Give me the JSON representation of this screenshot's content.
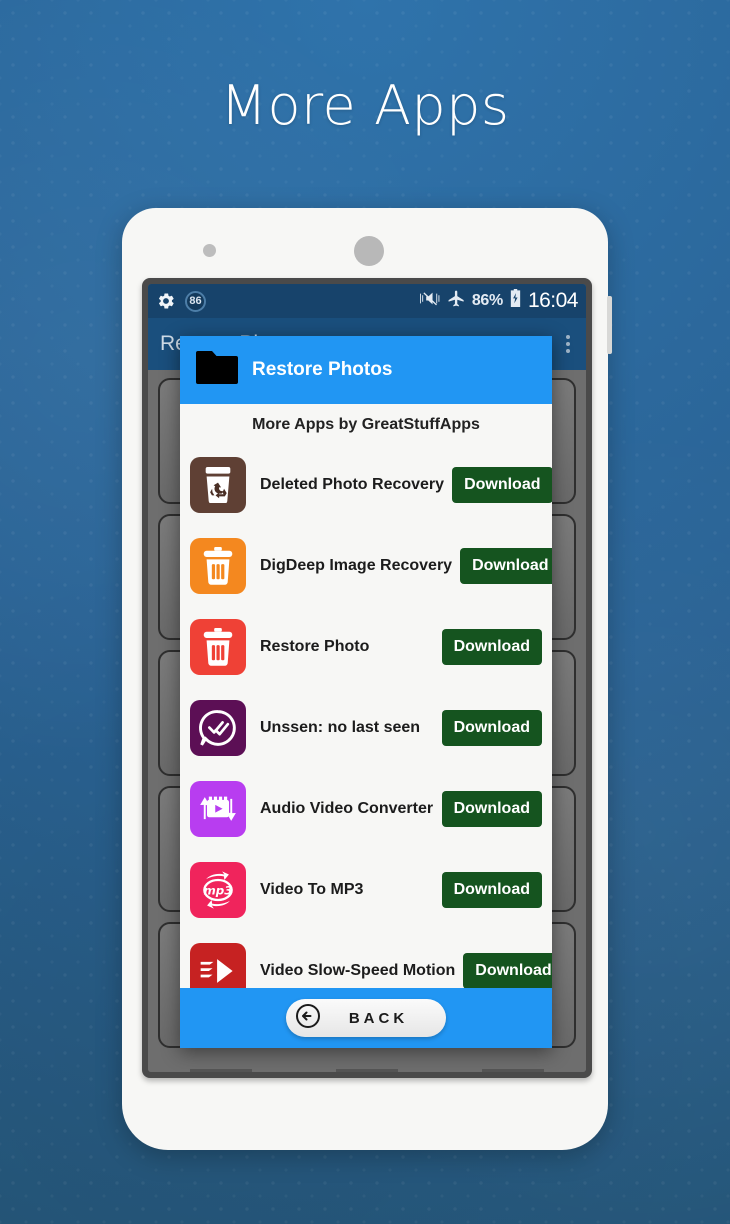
{
  "page": {
    "headline": "More Apps",
    "background_color": "#2a6395",
    "accent_blue": "#2196f3",
    "download_green": "#15541f"
  },
  "statusbar": {
    "gear_icon": "gear-icon",
    "notification_count": "86",
    "vibrate_icon": "vibrate-mute-icon",
    "airplane_icon": "airplane-mode-icon",
    "battery_percent": "86%",
    "battery_icon": "battery-charging-icon",
    "clock": "16:04"
  },
  "appbar": {
    "title": "Restore Photos",
    "overflow_icon": "overflow-menu-icon"
  },
  "dialog": {
    "icon": "folder-icon",
    "title": "Restore Photos",
    "list_heading": "More Apps by GreatStuffApps",
    "apps": [
      {
        "name": "Deleted Photo Recovery",
        "button": "Download",
        "icon": "recycle-bin-icon",
        "icon_bg": "#5f4034",
        "icon_fg": "#ffffff"
      },
      {
        "name": "DigDeep Image Recovery",
        "button": "Download",
        "icon": "trash-bin-icon",
        "icon_bg": "#f4881f",
        "icon_fg": "#ffffff"
      },
      {
        "name": "Restore Photo",
        "button": "Download",
        "icon": "trash-bin-icon",
        "icon_bg": "#ef4136",
        "icon_fg": "#ffffff"
      },
      {
        "name": "Unssen: no last seen",
        "button": "Download",
        "icon": "double-check-chat-icon",
        "icon_bg": "#5c0f55",
        "icon_fg": "#ffffff"
      },
      {
        "name": "Audio Video Converter",
        "button": "Download",
        "icon": "video-convert-icon",
        "icon_bg": "#b83df0",
        "icon_fg": "#ffffff"
      },
      {
        "name": "Video To MP3",
        "button": "Download",
        "icon": "mp3-convert-icon",
        "icon_bg": "#f0245c",
        "icon_fg": "#ffffff"
      },
      {
        "name": "Video Slow-Speed Motion",
        "button": "Download",
        "icon": "slow-motion-play-icon",
        "icon_bg": "#c62222",
        "icon_fg": "#ffffff"
      }
    ],
    "footer": {
      "back_label": "BACK",
      "back_icon": "back-arrow-circle-icon"
    }
  }
}
